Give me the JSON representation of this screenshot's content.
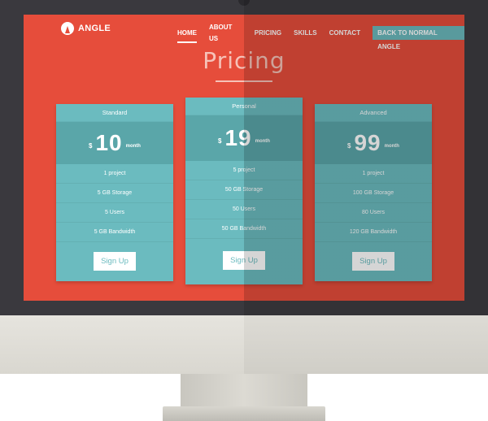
{
  "nav": {
    "logo_text": "ANGLE",
    "items": [
      {
        "label": "HOME",
        "active": true
      },
      {
        "label": "ABOUT US"
      },
      {
        "label": "PRICING"
      },
      {
        "label": "SKILLS"
      },
      {
        "label": "CONTACT"
      }
    ],
    "cta_label": "BACK TO NORMAL ANGLE"
  },
  "pricing": {
    "heading": "Pricing",
    "plans": [
      {
        "name": "Standard",
        "currency": "$",
        "amount": "10",
        "period": "month",
        "features": [
          "1 project",
          "5 GB Storage",
          "5 Users",
          "5 GB Bandwidth"
        ],
        "button_label": "Sign Up"
      },
      {
        "name": "Personal",
        "currency": "$",
        "amount": "19",
        "period": "month",
        "features": [
          "5 project",
          "50 GB Storage",
          "50 Users",
          "50 GB Bandwidth"
        ],
        "button_label": "Sign Up"
      },
      {
        "name": "Advanced",
        "currency": "$",
        "amount": "99",
        "period": "month",
        "features": [
          "1 project",
          "100 GB Storage",
          "80 Users",
          "120 GB Bandwidth"
        ],
        "button_label": "Sign Up"
      }
    ]
  },
  "colors": {
    "background_red": "#e64d3b",
    "card_teal": "#6bbbbf",
    "card_price_teal": "#5aa6a9",
    "monitor_bezel": "#3a393e"
  },
  "icons": {
    "logo": "angle-logo-icon"
  }
}
